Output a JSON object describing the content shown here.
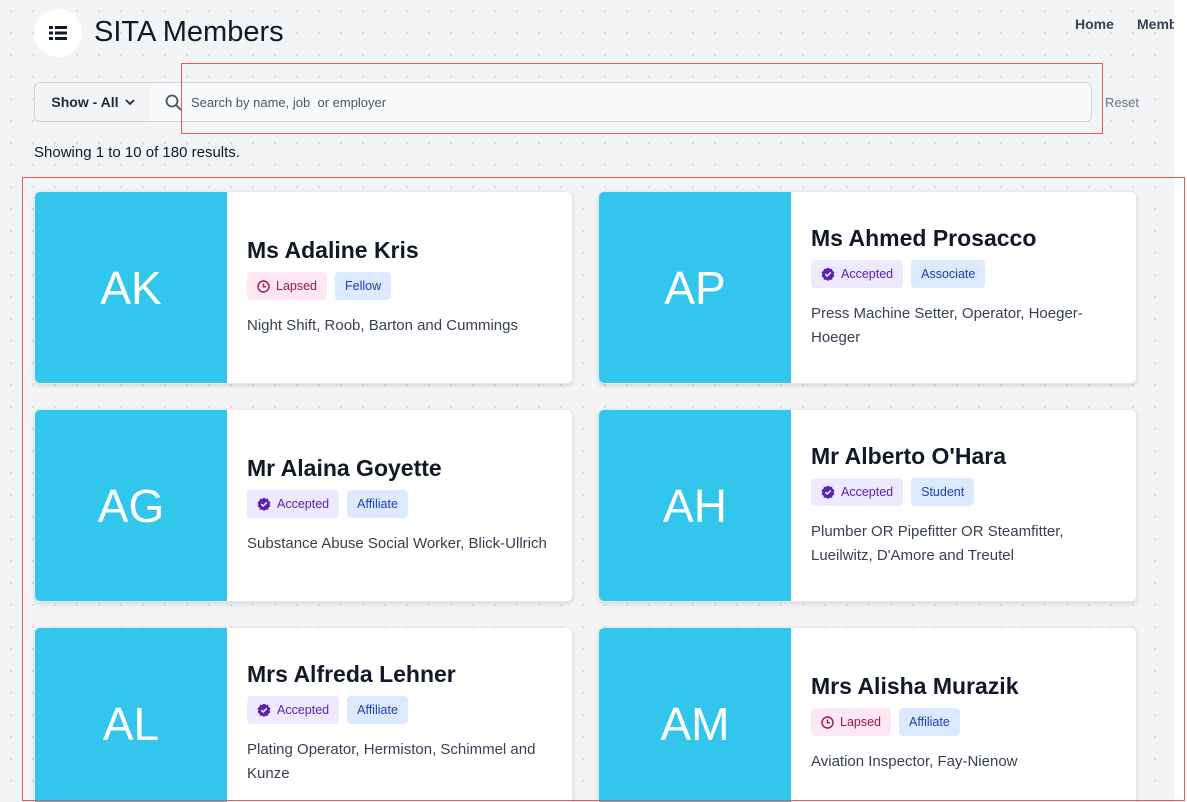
{
  "header": {
    "title": "SITA Members",
    "nav": [
      "Home",
      "Members"
    ]
  },
  "search": {
    "filter_label": "Show - All",
    "placeholder": "Search by name, job  or employer",
    "value": "",
    "reset_label": "Reset"
  },
  "results_text": "Showing 1 to 10 of 180 results.",
  "colors": {
    "avatar": "#33c6ec",
    "lapsed_bg": "#fce7f3",
    "accepted_bg": "#ede9fe",
    "type_bg": "#dbeafe"
  },
  "members": [
    {
      "initials": "AK",
      "name": "Ms Adaline Kris",
      "status": "Lapsed",
      "type": "Fellow",
      "info": "Night Shift, Roob, Barton and Cummings"
    },
    {
      "initials": "AP",
      "name": "Ms Ahmed Prosacco",
      "status": "Accepted",
      "type": "Associate",
      "info": "Press Machine Setter, Operator, Hoeger-Hoeger"
    },
    {
      "initials": "AG",
      "name": "Mr Alaina Goyette",
      "status": "Accepted",
      "type": "Affiliate",
      "info": "Substance Abuse Social Worker, Blick-Ullrich"
    },
    {
      "initials": "AH",
      "name": "Mr Alberto O'Hara",
      "status": "Accepted",
      "type": "Student",
      "info": "Plumber OR Pipefitter OR Steamfitter, Lueilwitz, D'Amore and Treutel"
    },
    {
      "initials": "AL",
      "name": "Mrs Alfreda Lehner",
      "status": "Accepted",
      "type": "Affiliate",
      "info": "Plating Operator, Hermiston, Schimmel and Kunze"
    },
    {
      "initials": "AM",
      "name": "Mrs Alisha Murazik",
      "status": "Lapsed",
      "type": "Affiliate",
      "info": "Aviation Inspector, Fay-Nienow"
    }
  ]
}
